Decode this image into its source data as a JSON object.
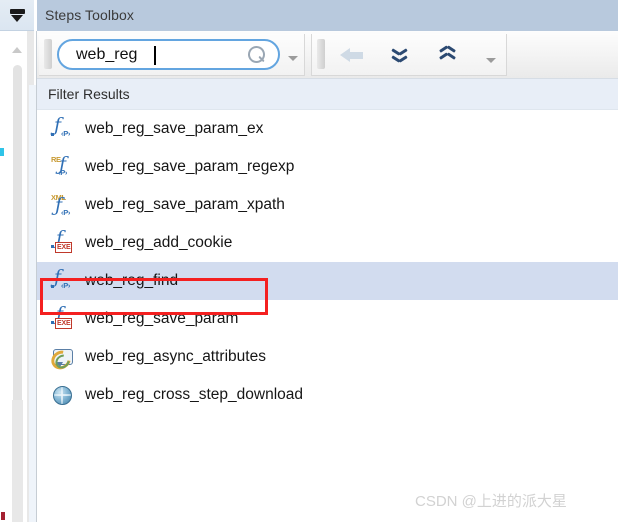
{
  "panel": {
    "title": "Steps Toolbox",
    "funnel_icon": "funnel-filter-icon"
  },
  "toolbar": {
    "search": {
      "value": "web_reg",
      "placeholder": "",
      "icon": "search-magnifier-icon",
      "dropdown_icon": "chevron-down-icon"
    },
    "buttons": [
      {
        "name": "back",
        "icon": "arrow-left-icon",
        "enabled": false
      },
      {
        "name": "next-match",
        "icon": "double-chevron-down-icon",
        "enabled": true
      },
      {
        "name": "previous-match",
        "icon": "double-chevron-up-icon",
        "enabled": true
      }
    ],
    "overflow_icon": "chevron-down-icon"
  },
  "filter_results": {
    "header": "Filter Results",
    "items": [
      {
        "label": "web_reg_save_param_ex",
        "icon": "function-param-icon",
        "icon_type": "fp",
        "selected": false
      },
      {
        "label": "web_reg_save_param_regexp",
        "icon": "function-regexp-param-icon",
        "icon_type": "fp-re",
        "selected": false
      },
      {
        "label": "web_reg_save_param_xpath",
        "icon": "function-xml-param-icon",
        "icon_type": "fp-xml",
        "selected": false
      },
      {
        "label": "web_reg_add_cookie",
        "icon": "function-exe-icon",
        "icon_type": "fexe",
        "selected": false
      },
      {
        "label": "web_reg_find",
        "icon": "function-param-icon",
        "icon_type": "fp",
        "selected": true
      },
      {
        "label": "web_reg_save_param",
        "icon": "function-exe-icon",
        "icon_type": "fexe",
        "selected": false
      },
      {
        "label": "web_reg_async_attributes",
        "icon": "async-bubble-icon",
        "icon_type": "async",
        "selected": false
      },
      {
        "label": "web_reg_cross_step_download",
        "icon": "globe-icon",
        "icon_type": "globe",
        "selected": false
      }
    ]
  },
  "icon_glyphs": {
    "f": "ƒ",
    "param_sub": "‹P›",
    "re_prefix": "RE",
    "xml_prefix": "XML",
    "exe": "EXE"
  },
  "annotation": {
    "target_label": "web_reg_find",
    "color": "#f42020"
  },
  "watermark": {
    "text": "CSDN @上进的派大星"
  },
  "colors": {
    "titlebar": "#b8c9dd",
    "filter_header": "#e8eef7",
    "selection": "#d2dcef",
    "search_border": "#63a5e0",
    "annotation": "#f42020",
    "icon_blue": "#2f6fb5",
    "icon_red": "#c0392b",
    "icon_gold": "#c89a33"
  }
}
